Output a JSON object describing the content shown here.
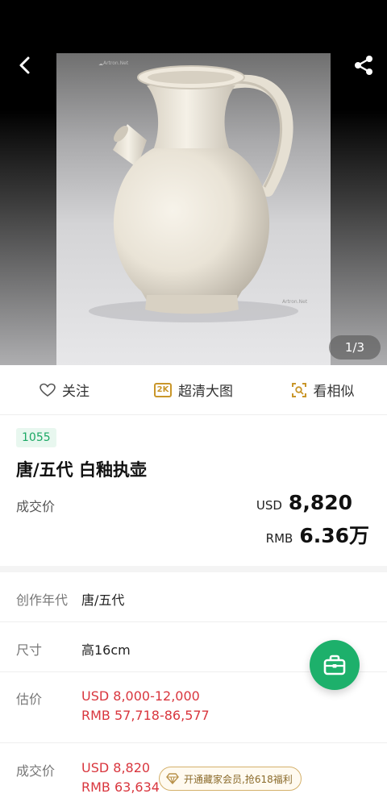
{
  "header": {
    "back_icon": "chevron-left-icon",
    "share_icon": "share-icon"
  },
  "image": {
    "watermark": "Artron.Net",
    "pager": "1/3"
  },
  "actions": {
    "follow": "关注",
    "hd": "超清大图",
    "hd_badge": "2K",
    "similar": "看相似"
  },
  "lot": {
    "number": "1055",
    "title": "唐/五代 白釉执壶",
    "sold_label": "成交价",
    "usd_currency": "USD",
    "usd_price": "8,820",
    "rmb_currency": "RMB",
    "rmb_price": "6.36万"
  },
  "details": [
    {
      "label": "创作年代",
      "value": "唐/五代"
    },
    {
      "label": "尺寸",
      "value": "高16cm"
    },
    {
      "label": "估价",
      "line1": "USD  8,000-12,000",
      "line2": "RMB 57,718-86,577"
    },
    {
      "label": "成交价",
      "line1": "USD 8,820",
      "line2": "RMB 63,634"
    }
  ],
  "promo": {
    "text": "开通藏家会员,抢618福利"
  },
  "colors": {
    "accent_green": "#1db06b",
    "price_red": "#d9363e",
    "gold": "#c9962a"
  }
}
